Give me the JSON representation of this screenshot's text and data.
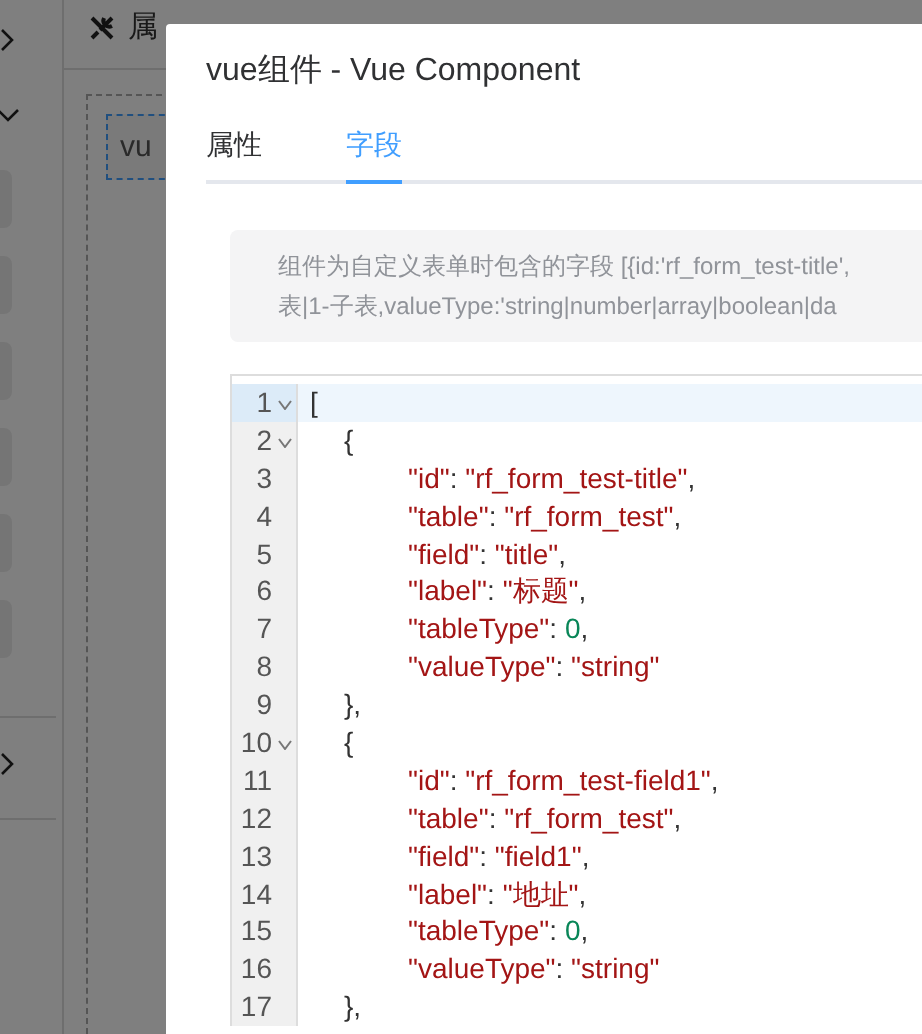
{
  "sidebar": {
    "items": [
      {
        "kind": "chevron-right"
      },
      {
        "kind": "chevron-down"
      },
      {
        "kind": "block"
      },
      {
        "kind": "block"
      },
      {
        "kind": "block"
      },
      {
        "kind": "block"
      },
      {
        "kind": "block"
      },
      {
        "kind": "block"
      },
      {
        "kind": "divider"
      },
      {
        "kind": "chevron-right"
      },
      {
        "kind": "divider"
      }
    ]
  },
  "toolbar": {
    "items": [
      {
        "label": "属"
      }
    ]
  },
  "canvas": {
    "component_label": "vu"
  },
  "dialog": {
    "title": "vue组件 - Vue Component",
    "tabs": [
      {
        "label": "属性",
        "selected": false
      },
      {
        "label": "字段",
        "selected": true
      }
    ],
    "info_lines": [
      "组件为自定义表单时包含的字段 [{id:'rf_form_test-title',",
      "表|1-子表,valueType:'string|number|array|boolean|da"
    ],
    "code": [
      {
        "number": "1",
        "foldable": true,
        "active": true,
        "tokens": [
          {
            "kind": "punct",
            "text": "["
          }
        ],
        "children": [
          {
            "number": "2",
            "foldable": true,
            "active": false,
            "tokens": [
              {
                "kind": "punct",
                "text": "{"
              }
            ],
            "children": [
              {
                "number": "3",
                "foldable": false,
                "active": false,
                "tokens": [
                  {
                    "kind": "key",
                    "text": "\"id\""
                  },
                  {
                    "kind": "punct",
                    "text": ": "
                  },
                  {
                    "kind": "string",
                    "text": "\"rf_form_test-title\""
                  },
                  {
                    "kind": "punct",
                    "text": ","
                  }
                ]
              },
              {
                "number": "4",
                "foldable": false,
                "active": false,
                "tokens": [
                  {
                    "kind": "key",
                    "text": "\"table\""
                  },
                  {
                    "kind": "punct",
                    "text": ": "
                  },
                  {
                    "kind": "string",
                    "text": "\"rf_form_test\""
                  },
                  {
                    "kind": "punct",
                    "text": ","
                  }
                ]
              },
              {
                "number": "5",
                "foldable": false,
                "active": false,
                "tokens": [
                  {
                    "kind": "key",
                    "text": "\"field\""
                  },
                  {
                    "kind": "punct",
                    "text": ": "
                  },
                  {
                    "kind": "string",
                    "text": "\"title\""
                  },
                  {
                    "kind": "punct",
                    "text": ","
                  }
                ]
              },
              {
                "number": "6",
                "foldable": false,
                "active": false,
                "tokens": [
                  {
                    "kind": "key",
                    "text": "\"label\""
                  },
                  {
                    "kind": "punct",
                    "text": ": "
                  },
                  {
                    "kind": "string",
                    "text": "\"标题\""
                  },
                  {
                    "kind": "punct",
                    "text": ","
                  }
                ]
              },
              {
                "number": "7",
                "foldable": false,
                "active": false,
                "tokens": [
                  {
                    "kind": "key",
                    "text": "\"tableType\""
                  },
                  {
                    "kind": "punct",
                    "text": ": "
                  },
                  {
                    "kind": "number",
                    "text": "0"
                  },
                  {
                    "kind": "punct",
                    "text": ","
                  }
                ]
              },
              {
                "number": "8",
                "foldable": false,
                "active": false,
                "tokens": [
                  {
                    "kind": "key",
                    "text": "\"valueType\""
                  },
                  {
                    "kind": "punct",
                    "text": ": "
                  },
                  {
                    "kind": "string",
                    "text": "\"string\""
                  }
                ]
              }
            ]
          },
          {
            "number": "9",
            "foldable": false,
            "active": false,
            "tokens": [
              {
                "kind": "punct",
                "text": "},"
              }
            ]
          },
          {
            "number": "10",
            "foldable": true,
            "active": false,
            "tokens": [
              {
                "kind": "punct",
                "text": "{"
              }
            ],
            "children": [
              {
                "number": "11",
                "foldable": false,
                "active": false,
                "tokens": [
                  {
                    "kind": "key",
                    "text": "\"id\""
                  },
                  {
                    "kind": "punct",
                    "text": ": "
                  },
                  {
                    "kind": "string",
                    "text": "\"rf_form_test-field1\""
                  },
                  {
                    "kind": "punct",
                    "text": ","
                  }
                ]
              },
              {
                "number": "12",
                "foldable": false,
                "active": false,
                "tokens": [
                  {
                    "kind": "key",
                    "text": "\"table\""
                  },
                  {
                    "kind": "punct",
                    "text": ": "
                  },
                  {
                    "kind": "string",
                    "text": "\"rf_form_test\""
                  },
                  {
                    "kind": "punct",
                    "text": ","
                  }
                ]
              },
              {
                "number": "13",
                "foldable": false,
                "active": false,
                "tokens": [
                  {
                    "kind": "key",
                    "text": "\"field\""
                  },
                  {
                    "kind": "punct",
                    "text": ": "
                  },
                  {
                    "kind": "string",
                    "text": "\"field1\""
                  },
                  {
                    "kind": "punct",
                    "text": ","
                  }
                ]
              },
              {
                "number": "14",
                "foldable": false,
                "active": false,
                "tokens": [
                  {
                    "kind": "key",
                    "text": "\"label\""
                  },
                  {
                    "kind": "punct",
                    "text": ": "
                  },
                  {
                    "kind": "string",
                    "text": "\"地址\""
                  },
                  {
                    "kind": "punct",
                    "text": ","
                  }
                ]
              },
              {
                "number": "15",
                "foldable": false,
                "active": false,
                "tokens": [
                  {
                    "kind": "key",
                    "text": "\"tableType\""
                  },
                  {
                    "kind": "punct",
                    "text": ": "
                  },
                  {
                    "kind": "number",
                    "text": "0"
                  },
                  {
                    "kind": "punct",
                    "text": ","
                  }
                ]
              },
              {
                "number": "16",
                "foldable": false,
                "active": false,
                "tokens": [
                  {
                    "kind": "key",
                    "text": "\"valueType\""
                  },
                  {
                    "kind": "punct",
                    "text": ": "
                  },
                  {
                    "kind": "string",
                    "text": "\"string\""
                  }
                ]
              }
            ]
          },
          {
            "number": "17",
            "foldable": false,
            "active": false,
            "tokens": [
              {
                "kind": "punct",
                "text": "},"
              }
            ]
          }
        ]
      }
    ]
  }
}
